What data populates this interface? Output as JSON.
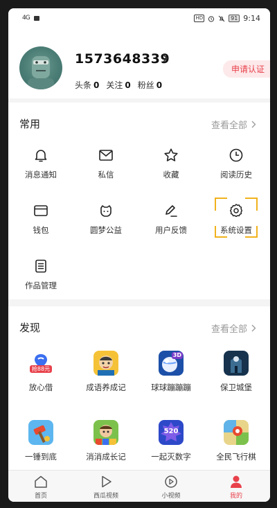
{
  "status_bar": {
    "signal": "4G",
    "hd": "HD",
    "battery": "91",
    "time": "9:14"
  },
  "profile": {
    "username": "1573648339",
    "stats": [
      {
        "label": "头条",
        "value": "0"
      },
      {
        "label": "关注",
        "value": "0"
      },
      {
        "label": "粉丝",
        "value": "0"
      }
    ],
    "certify_label": "申请认证"
  },
  "common": {
    "title": "常用",
    "more_label": "查看全部",
    "items": [
      {
        "label": "消息通知",
        "icon": "bell-icon"
      },
      {
        "label": "私信",
        "icon": "mail-icon"
      },
      {
        "label": "收藏",
        "icon": "star-icon"
      },
      {
        "label": "阅读历史",
        "icon": "clock-icon"
      },
      {
        "label": "钱包",
        "icon": "wallet-icon"
      },
      {
        "label": "圆梦公益",
        "icon": "charity-icon"
      },
      {
        "label": "用户反馈",
        "icon": "feedback-pen-icon"
      },
      {
        "label": "系统设置",
        "icon": "gear-icon"
      },
      {
        "label": "作品管理",
        "icon": "document-list-icon"
      }
    ]
  },
  "discover": {
    "title": "发现",
    "more_label": "查看全部",
    "games": [
      {
        "label": "放心借",
        "badge": "抢88元"
      },
      {
        "label": "成语养成记"
      },
      {
        "label": "球球蹦蹦蹦",
        "badge": "3D"
      },
      {
        "label": "保卫城堡"
      },
      {
        "label": "一锤到底"
      },
      {
        "label": "消消成长记"
      },
      {
        "label": "一起灭数字",
        "badge": "520"
      },
      {
        "label": "全民飞行棋"
      }
    ]
  },
  "bottom_nav": {
    "items": [
      {
        "label": "首页"
      },
      {
        "label": "西瓜视频"
      },
      {
        "label": "小视频"
      },
      {
        "label": "我的",
        "active": true
      }
    ]
  },
  "colors": {
    "accent_red": "#e8414b",
    "highlight_yellow": "#f1b21c"
  }
}
